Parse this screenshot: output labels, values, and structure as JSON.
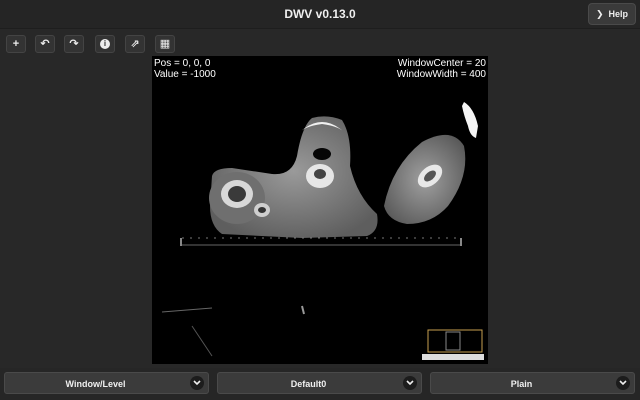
{
  "app": {
    "title": "DWV v0.13.0"
  },
  "header": {
    "help_label": "Help"
  },
  "toolbar": {
    "buttons": [
      {
        "name": "add-icon",
        "glyph": "+"
      },
      {
        "name": "undo-icon",
        "glyph": "↶"
      },
      {
        "name": "redo-icon",
        "glyph": "↷"
      },
      {
        "name": "info-icon",
        "glyph": "i"
      },
      {
        "name": "share-icon",
        "glyph": "⇗"
      },
      {
        "name": "grid-icon",
        "glyph": "▦"
      }
    ]
  },
  "viewer": {
    "overlay": {
      "pos": "Pos = 0, 0, 0",
      "value": "Value = -1000",
      "window_center": "WindowCenter = 20",
      "window_width": "WindowWidth = 400"
    }
  },
  "bottom": {
    "tool_select": "Window/Level",
    "preset_select": "Default0",
    "colormap_select": "Plain"
  },
  "colors": {
    "background": "#282828",
    "viewer_bg": "#000000",
    "button_bg": "#333333"
  }
}
